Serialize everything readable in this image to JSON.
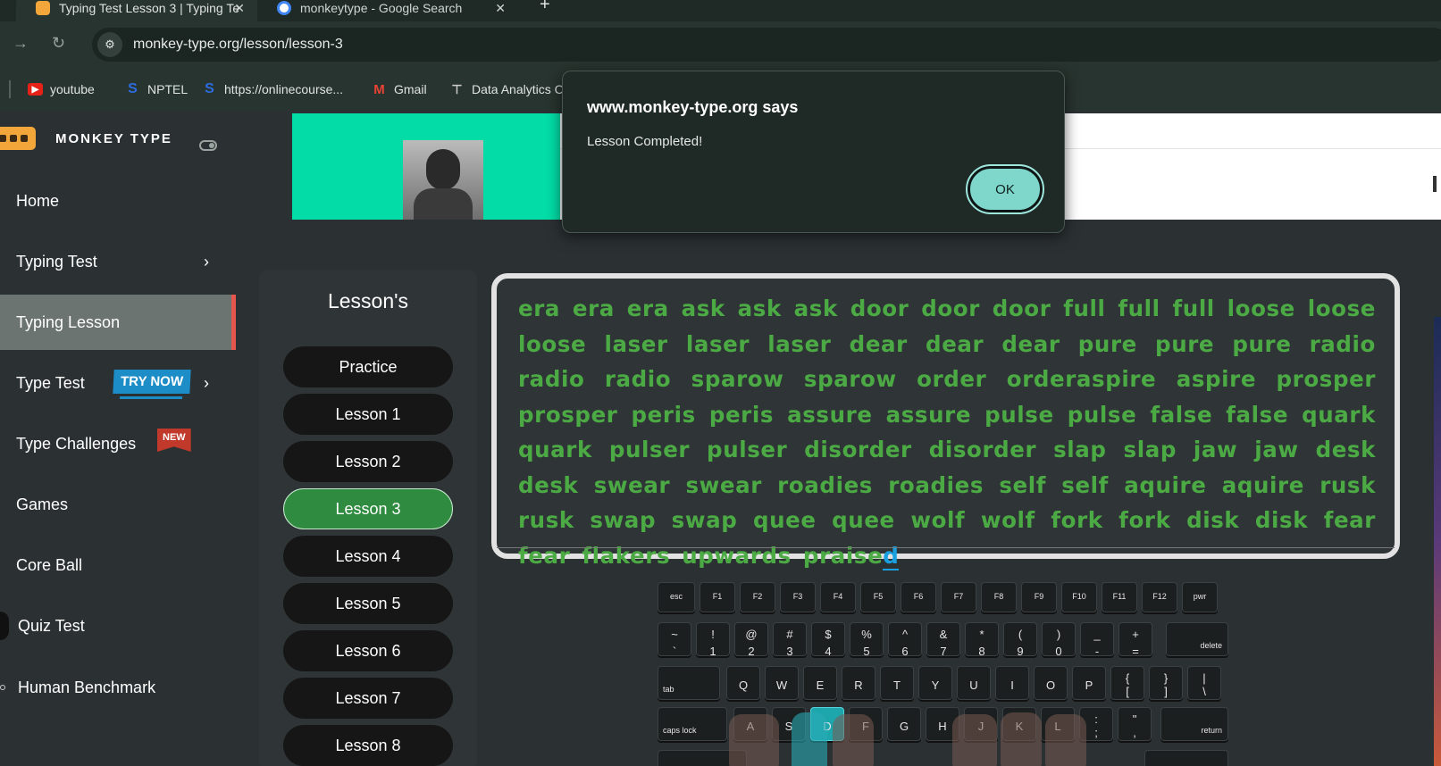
{
  "browser": {
    "tabs": [
      {
        "title": "Typing Test Lesson 3 | Typing Te",
        "active": true
      },
      {
        "title": "monkeytype - Google Search",
        "active": false
      }
    ],
    "url": "monkey-type.org/lesson/lesson-3",
    "bookmarks": [
      {
        "label": "youtube",
        "icon": "youtube-icon"
      },
      {
        "label": "NPTEL",
        "icon": "s-icon"
      },
      {
        "label": "https://onlinecourse...",
        "icon": "s-icon"
      },
      {
        "label": "Gmail",
        "icon": "gmail-icon"
      },
      {
        "label": "Data Analytics C",
        "icon": "analytics-icon"
      }
    ]
  },
  "sidebar": {
    "brand": "MONKEY TYPE",
    "items": [
      {
        "label": "Home"
      },
      {
        "label": "Typing Test"
      },
      {
        "label": "Typing Lesson"
      },
      {
        "label": "Type Test",
        "badge": "TRY NOW"
      },
      {
        "label": "Type Challenges",
        "badge": "NEW"
      },
      {
        "label": "Games"
      },
      {
        "label": "Core Ball"
      },
      {
        "label": "Quiz Test"
      },
      {
        "label": "Human Benchmark"
      }
    ]
  },
  "lessons": {
    "title": "Lesson's",
    "items": [
      "Practice",
      "Lesson 1",
      "Lesson 2",
      "Lesson 3",
      "Lesson 4",
      "Lesson 5",
      "Lesson 6",
      "Lesson 7",
      "Lesson 8"
    ],
    "active": "Lesson 3"
  },
  "typing": {
    "text_main": "era era era ask ask ask door door door full full full loose loose loose laser laser laser dear dear dear pure pure pure radio radio radio sparow sparow order orderaspire aspire prosper prosper peris peris assure assure pulse pulse false false quark quark pulser pulser disorder disorder slap slap jaw jaw desk desk swear swear roadies roadies self self aquire aquire rusk rusk swap swap quee quee wolf wolf fork fork disk disk fear fear flakers upwards praise",
    "text_cursor": "d"
  },
  "keyboard": {
    "fn_row": [
      "esc",
      "F1",
      "F2",
      "F3",
      "F4",
      "F5",
      "F6",
      "F7",
      "F8",
      "F9",
      "F10",
      "F11",
      "F12",
      "pwr"
    ],
    "num_row": [
      [
        "~",
        "`"
      ],
      [
        "!",
        "1"
      ],
      [
        "@",
        "2"
      ],
      [
        "#",
        "3"
      ],
      [
        "$",
        "4"
      ],
      [
        "%",
        "5"
      ],
      [
        "^",
        "6"
      ],
      [
        "&",
        "7"
      ],
      [
        "*",
        "8"
      ],
      [
        "(",
        "9"
      ],
      [
        ")",
        "0"
      ],
      [
        "_",
        "-"
      ],
      [
        "+",
        "="
      ]
    ],
    "delete": "delete",
    "tab": "tab",
    "q_row": [
      "Q",
      "W",
      "E",
      "R",
      "T",
      "Y",
      "U",
      "I",
      "O",
      "P"
    ],
    "q_row_sym": [
      [
        "{",
        "["
      ],
      [
        "}",
        "]"
      ],
      [
        "|",
        "\\"
      ]
    ],
    "caps": "caps lock",
    "a_row": [
      "A",
      "S",
      "D",
      "F",
      "G",
      "H",
      "J",
      "K",
      "L"
    ],
    "a_row_sym": [
      [
        ":",
        ";"
      ],
      [
        "\"",
        ","
      ]
    ],
    "return": "return",
    "highlighted": "D",
    "highlight_color": "#1ea6ad"
  },
  "dialog": {
    "title": "www.monkey-type.org says",
    "message": "Lesson Completed!",
    "ok": "OK"
  },
  "colors": {
    "typed_text": "#4caa44",
    "active_lesson": "#2e8b3f",
    "active_nav_marker": "#e5564c",
    "dialog_ok": "#7fd6cb"
  }
}
